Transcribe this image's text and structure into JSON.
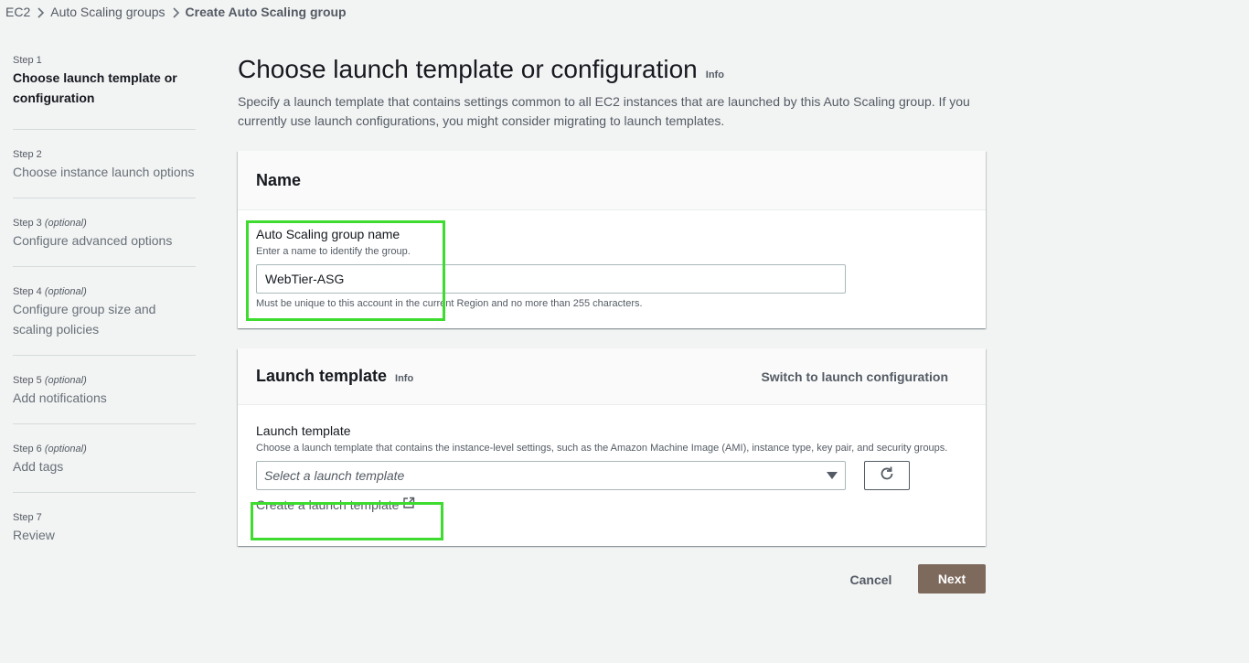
{
  "breadcrumb": {
    "items": [
      "EC2",
      "Auto Scaling groups",
      "Create Auto Scaling group"
    ]
  },
  "steps": [
    {
      "num": "Step 1",
      "optional": "",
      "title": "Choose launch template or configuration"
    },
    {
      "num": "Step 2",
      "optional": "",
      "title": "Choose instance launch options"
    },
    {
      "num": "Step 3",
      "optional": "(optional)",
      "title": "Configure advanced options"
    },
    {
      "num": "Step 4",
      "optional": "(optional)",
      "title": "Configure group size and scaling policies"
    },
    {
      "num": "Step 5",
      "optional": "(optional)",
      "title": "Add notifications"
    },
    {
      "num": "Step 6",
      "optional": "(optional)",
      "title": "Add tags"
    },
    {
      "num": "Step 7",
      "optional": "",
      "title": "Review"
    }
  ],
  "page": {
    "title": "Choose launch template or configuration",
    "info": "Info",
    "description": "Specify a launch template that contains settings common to all EC2 instances that are launched by this Auto Scaling group. If you currently use launch configurations, you might consider migrating to launch templates."
  },
  "name_panel": {
    "heading": "Name",
    "label": "Auto Scaling group name",
    "description": "Enter a name to identify the group.",
    "value": "WebTier-ASG",
    "constraint": "Must be unique to this account in the current Region and no more than 255 characters."
  },
  "template_panel": {
    "heading": "Launch template",
    "info": "Info",
    "switch_link": "Switch to launch configuration",
    "label": "Launch template",
    "description": "Choose a launch template that contains the instance-level settings, such as the Amazon Machine Image (AMI), instance type, key pair, and security groups.",
    "select_placeholder": "Select a launch template",
    "create_link": "Create a launch template"
  },
  "actions": {
    "cancel": "Cancel",
    "next": "Next"
  },
  "colors": {
    "highlight": "#3ddc2f",
    "primary_button": "#7d6a5c",
    "background": "#f2f3f3"
  },
  "icons": [
    "chevron-right-icon",
    "caret-down-icon",
    "refresh-icon",
    "external-link-icon"
  ]
}
